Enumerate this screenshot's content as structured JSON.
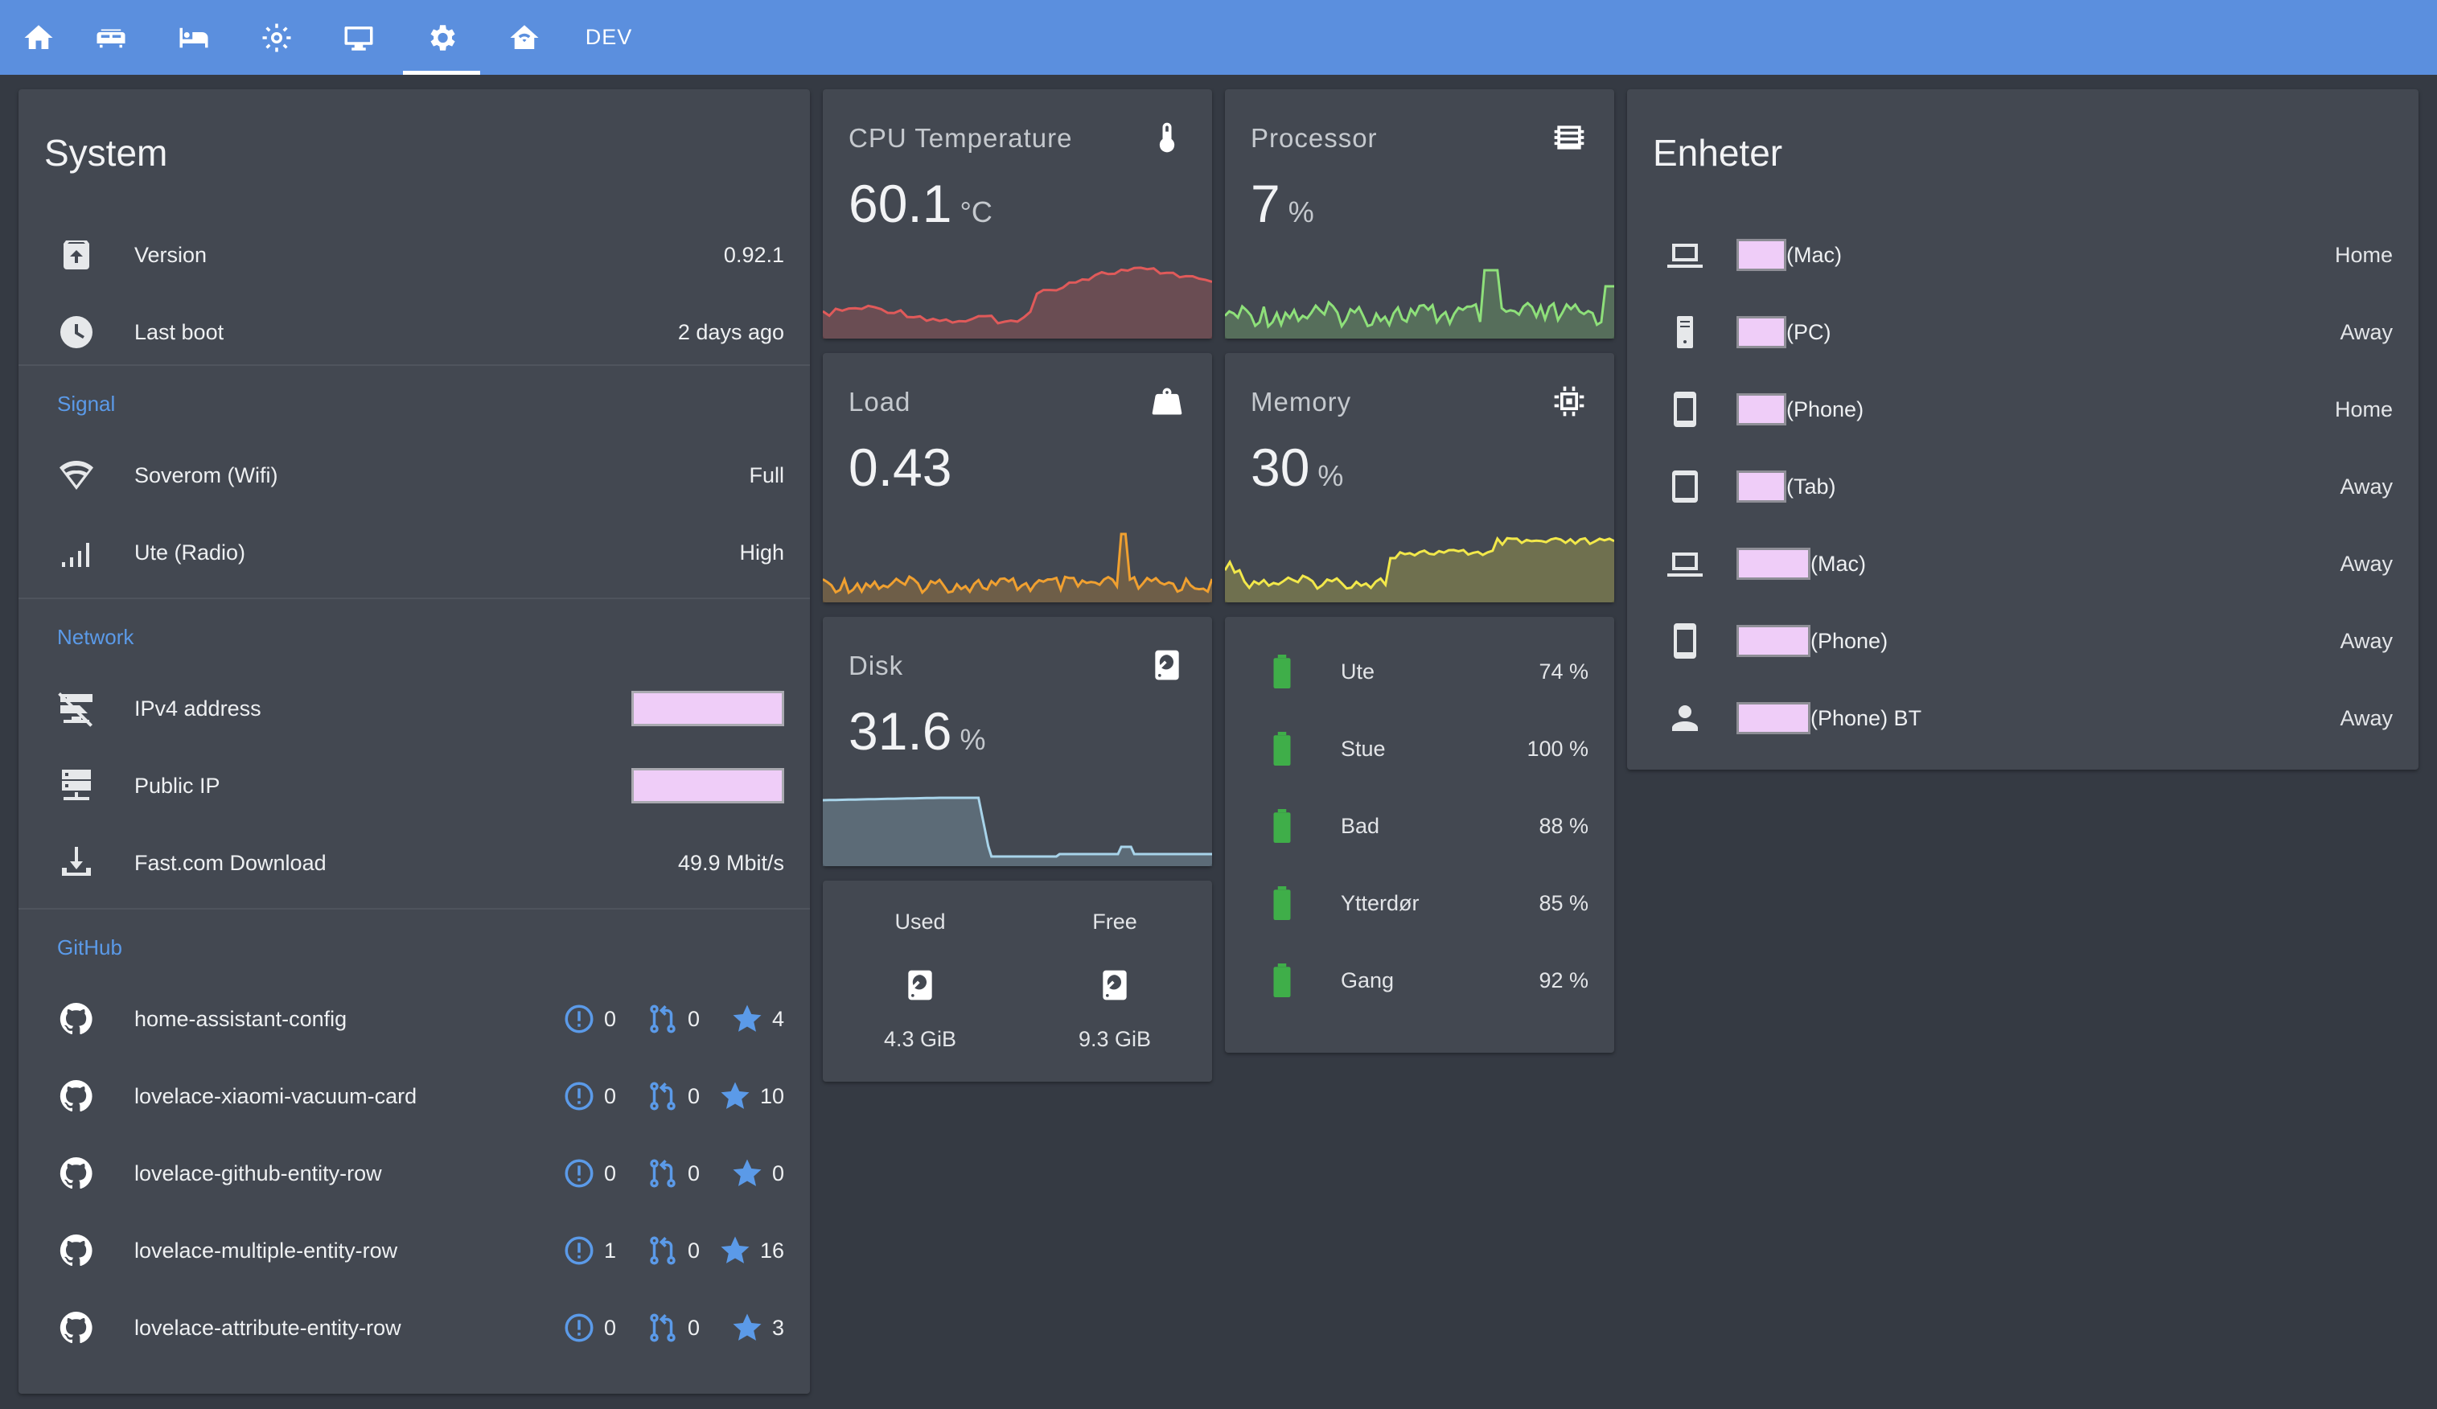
{
  "topbar": {
    "dev_label": "DEV",
    "accent": "#5b8fde"
  },
  "system": {
    "title": "System",
    "rows": [
      {
        "icon": "package-up-icon",
        "label": "Version",
        "value": "0.92.1"
      },
      {
        "icon": "clock-icon",
        "label": "Last boot",
        "value": "2 days ago"
      }
    ],
    "signal": {
      "title": "Signal",
      "rows": [
        {
          "icon": "wifi-icon",
          "label": "Soverom (Wifi)",
          "value": "Full"
        },
        {
          "icon": "signal-bars-icon",
          "label": "Ute (Radio)",
          "value": "High"
        }
      ]
    },
    "network": {
      "title": "Network",
      "rows": [
        {
          "icon": "server-network-off-icon",
          "label": "IPv4 address"
        },
        {
          "icon": "server-network-icon",
          "label": "Public IP"
        },
        {
          "icon": "download-icon",
          "label": "Fast.com Download",
          "value": "49.9 Mbit/s"
        }
      ]
    },
    "github": {
      "title": "GitHub",
      "repos": [
        {
          "name": "home-assistant-config",
          "issues": "0",
          "prs": "0",
          "stars": "4"
        },
        {
          "name": "lovelace-xiaomi-vacuum-card",
          "issues": "0",
          "prs": "0",
          "stars": "10"
        },
        {
          "name": "lovelace-github-entity-row",
          "issues": "0",
          "prs": "0",
          "stars": "0"
        },
        {
          "name": "lovelace-multiple-entity-row",
          "issues": "1",
          "prs": "0",
          "stars": "16"
        },
        {
          "name": "lovelace-attribute-entity-row",
          "issues": "0",
          "prs": "0",
          "stars": "3"
        }
      ]
    }
  },
  "sensors": {
    "cpu_temp": {
      "name": "CPU Temperature",
      "value": "60.1",
      "unit": "°C",
      "color": "#e05a5a"
    },
    "processor": {
      "name": "Processor",
      "value": "7",
      "unit": "%",
      "color": "#8ee07a"
    },
    "load": {
      "name": "Load",
      "value": "0.43",
      "unit": "",
      "color": "#f0a030"
    },
    "memory": {
      "name": "Memory",
      "value": "30",
      "unit": "%",
      "color": "#f2e84a"
    },
    "disk": {
      "name": "Disk",
      "value": "31.6",
      "unit": "%",
      "color": "#a8d4ea"
    }
  },
  "disk_usage": {
    "used_label": "Used",
    "used_value": "4.3 GiB",
    "free_label": "Free",
    "free_value": "9.3 GiB"
  },
  "batteries": {
    "color": "#3fae49",
    "items": [
      {
        "name": "Ute",
        "value": "74 %"
      },
      {
        "name": "Stue",
        "value": "100 %"
      },
      {
        "name": "Bad",
        "value": "88 %"
      },
      {
        "name": "Ytterdør",
        "value": "85 %"
      },
      {
        "name": "Gang",
        "value": "92 %"
      }
    ]
  },
  "devices": {
    "title": "Enheter",
    "items": [
      {
        "icon": "laptop-icon",
        "name": "(Mac)",
        "state": "Home"
      },
      {
        "icon": "desktop-tower-icon",
        "name": "(PC)",
        "state": "Away"
      },
      {
        "icon": "cellphone-icon",
        "name": "(Phone)",
        "state": "Home"
      },
      {
        "icon": "tablet-icon",
        "name": "(Tab)",
        "state": "Away"
      },
      {
        "icon": "laptop-icon",
        "name": "(Mac)",
        "state": "Away"
      },
      {
        "icon": "cellphone-icon",
        "name": "(Phone)",
        "state": "Away"
      },
      {
        "icon": "account-icon",
        "name": "(Phone) BT",
        "state": "Away"
      }
    ]
  }
}
